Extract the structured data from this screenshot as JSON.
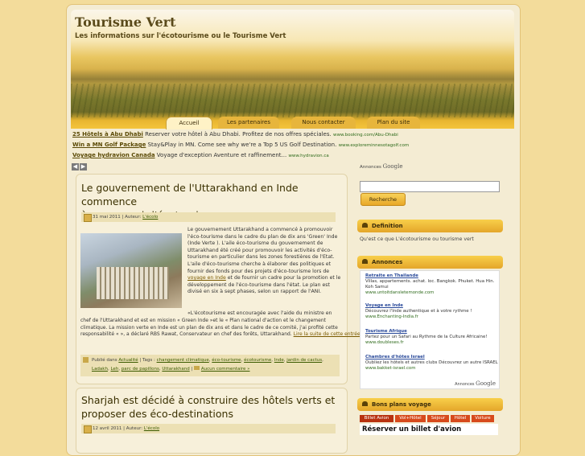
{
  "site": {
    "title": "Tourisme Vert",
    "description": "Les informations sur l'écotourisme ou le Tourisme Vert"
  },
  "nav": {
    "items": [
      {
        "label": "Accueil",
        "active": true
      },
      {
        "label": "Les partenaires",
        "active": false
      },
      {
        "label": "Nous contacter",
        "active": false
      },
      {
        "label": "Plan du site",
        "active": false
      }
    ]
  },
  "adlinks": [
    {
      "title": "25 Hôtels à Abu Dhabi",
      "text": "Reserver votre hôtel à Abu Dhabi. Profitez de nos offres spéciales.",
      "url": "www.booking.com/Abu-Dhabi"
    },
    {
      "title": "Win a MN Golf Package",
      "text": "Stay&Play in MN. Come see why we're a Top 5 US Golf Destination.",
      "url": "www.exploreminnesotagolf.com"
    },
    {
      "title": "Voyage hydravion Canada",
      "text": "Voyage d'exception Aventure et raffinement...",
      "url": "www.hydravion.ca"
    }
  ],
  "pager": {
    "prev": "◀",
    "next": "▶"
  },
  "posts": [
    {
      "title_line1": "Le gouvernement de l'Uttarakhand en Inde commence",
      "title_line2": "à promouvoir l'écotourisme",
      "date": "31 mai 2011",
      "author_label": "Auteur:",
      "author": "L'écolo",
      "para1": {
        "lines": [
          "Le gouvernement Uttarakhand a commencé à promouvoir",
          "l'éco-tourisme dans le cadre du plan de dix ans 'Green' Inde",
          "(Inde Verte ). L'aile éco-tourisme du gouvernement de",
          "Uttarakhand été créé pour promouvoir les activités d'éco-",
          "tourisme en particulier dans les zones forestières de l'Etat.",
          "L'aile d'éco-tourisme cherche à élaborer des politiques et",
          "fournir des fonds pour des projets d'éco-tourisme lors de"
        ],
        "link": "voyage en Inde",
        "lines_after": [
          "et de fournir un cadre pour la promotion et le",
          "développement de l'éco-tourisme dans l'état. Le plan est",
          "divisé en six à sept phases, selon un rapport de l'ANI."
        ]
      },
      "para2": {
        "line1": "«L'écotourisme est encouragée avec l'aide du ministre en",
        "line2": "chef de l'Uttarakhand et est en mission  « Green Inde »et le « Plan national d'action et le changement",
        "line3": "climatique. La mission verte en Inde est un plan de dix ans et dans le cadre de ce comité, j'ai profité cette",
        "line4": "responsabilité « », a déclaré RBS Rawat, Conservateur en chef des forêts, Uttarakhand.",
        "more": "Lire la suite de cette entrée »"
      },
      "footer": {
        "posted_in": "Publié dans",
        "category": "Actualité",
        "tags_label": "Tags :",
        "tags": [
          "changement climatique",
          "éco-tourisme",
          "écotourisme",
          "Inde",
          "jardin de cactus",
          "Ladakh",
          "Leh",
          "parc de papillons",
          "Uttarakhand"
        ],
        "comments": "Aucun commentaire »"
      }
    },
    {
      "title_line1": "Sharjah est décidé à construire des hôtels verts et",
      "title_line2": "proposer des éco-destinations",
      "date": "12 avril 2011",
      "author_label": "Auteur:",
      "author": "L'écolo"
    }
  ],
  "sidebar": {
    "google_ads_label": "Annonces",
    "google_word": "Google",
    "search": {
      "value": "",
      "button": "Recherche"
    },
    "definition": {
      "heading": "Definition",
      "text": "Qu'est ce que L'écotourisme ou tourisme vert"
    },
    "annonces": {
      "heading": "Annonces",
      "ads": [
        {
          "title": "Retraite en Thaïlande",
          "text1": "Villas, appartements. achat. loc. Bangkok. Phuket. Hua Hin.",
          "text2": "Koh Samui",
          "url": "www.untoitdansletemonde.com"
        },
        {
          "title": "Voyage en Inde",
          "text1": "Découvrez l'Inde authentique et à votre rythme !",
          "text2": "",
          "url": "www.Enchanting-India.fr"
        },
        {
          "title": "Tourisme Afrique",
          "text1": "Partez pour un Safari au Rythme de la Culture Africaine!",
          "text2": "",
          "url": "www.doubleses.fr"
        },
        {
          "title": "Chambres d'hôtes Israel",
          "text1": "Oubliez les hôtels et autres clubs Découvrez un autre ISRAEL",
          "text2": "",
          "url": "www.bakket-israel.com"
        }
      ],
      "footer_label": "Annonces",
      "footer_google": "Google"
    },
    "bons_plans": {
      "heading": "Bons plans voyage",
      "tabs": [
        "Billet Avion",
        "Vol+Hôtel",
        "Séjour",
        "Hôtel",
        "Voiture"
      ],
      "reserve_title": "Réserver un billet d'avion"
    }
  },
  "colors": {
    "accent": "#e8a828",
    "background": "#f3dc9b",
    "link": "#2a4a9a",
    "tab_red": "#d74a1c"
  }
}
